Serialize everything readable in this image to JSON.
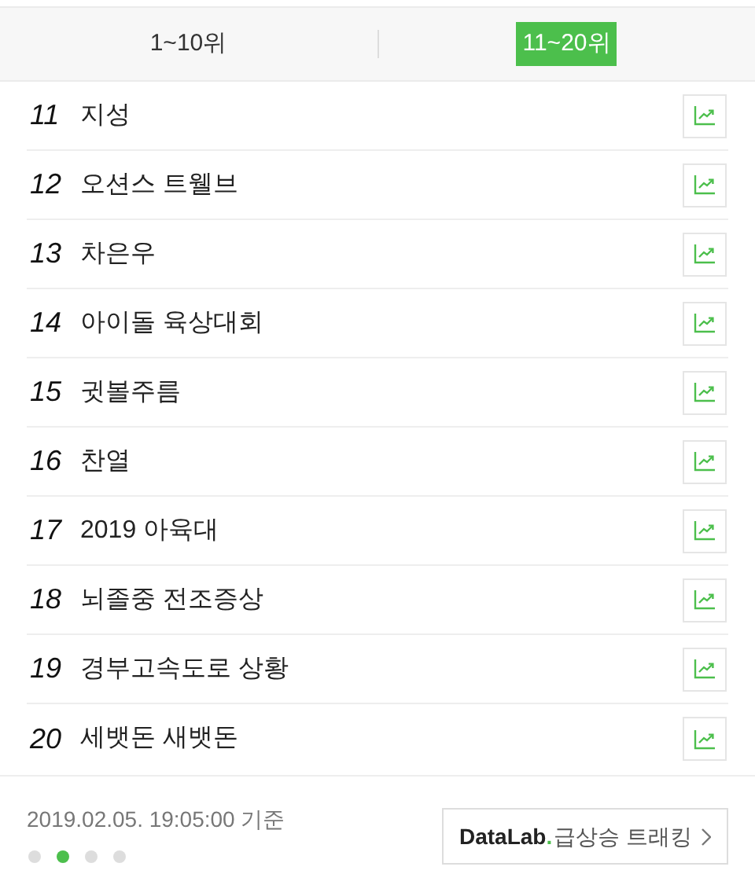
{
  "tabs": [
    {
      "label": "1~10위",
      "selected": false
    },
    {
      "label": "11~20위",
      "selected": true
    }
  ],
  "rows": [
    {
      "rank": "11",
      "keyword": "지성"
    },
    {
      "rank": "12",
      "keyword": "오션스 트웰브"
    },
    {
      "rank": "13",
      "keyword": "차은우"
    },
    {
      "rank": "14",
      "keyword": "아이돌 육상대회"
    },
    {
      "rank": "15",
      "keyword": "귓볼주름"
    },
    {
      "rank": "16",
      "keyword": "찬열"
    },
    {
      "rank": "17",
      "keyword": "2019 아육대"
    },
    {
      "rank": "18",
      "keyword": "뇌졸중 전조증상"
    },
    {
      "rank": "19",
      "keyword": "경부고속도로 상황"
    },
    {
      "rank": "20",
      "keyword": "세뱃돈 새뱃돈"
    }
  ],
  "footer": {
    "timestamp": "2019.02.05. 19:05:00 기준",
    "pager": [
      {
        "selected": false
      },
      {
        "selected": true
      },
      {
        "selected": false
      },
      {
        "selected": false
      }
    ],
    "datalab_button": {
      "brand": "DataLab",
      "dot": ".",
      "label": "급상승 트래킹"
    }
  }
}
